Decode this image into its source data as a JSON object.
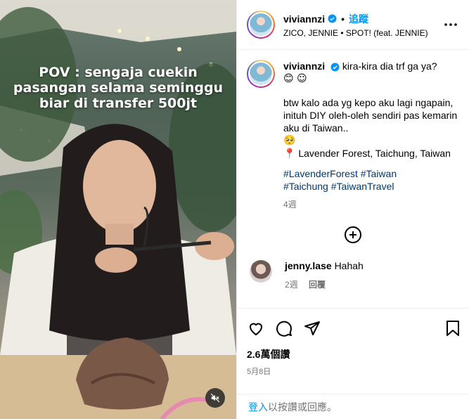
{
  "media": {
    "caption_lines": [
      "POV : sengaja cuekin",
      "pasangan selama seminggu",
      "biar di transfer 500jt"
    ],
    "mute_icon": "muted-speaker-icon"
  },
  "header": {
    "username": "viviannzi",
    "follow_label": "追蹤",
    "dot": "•",
    "music": "ZICO, JENNIE • SPOT! (feat. JENNIE)"
  },
  "post": {
    "username": "viviannzi",
    "text_line1": "kira-kira dia trf ga ya?",
    "emoji1": "😊 ☺",
    "para2": "btw kalo ada yg kepo aku lagi ngapain, inituh DIY oleh-oleh sendiri pas kemarin aku di Taiwan..",
    "emoji2": "🥺",
    "pin": "📍",
    "location": "Lavender Forest, Taichung, Taiwan",
    "tags": [
      "#LavenderForest",
      "#Taiwan",
      "#Taichung",
      "#TaiwanTravel"
    ],
    "age": "4週"
  },
  "comment": {
    "username": "jenny.lase",
    "text": "Hahah",
    "age": "2週",
    "reply_label": "回覆"
  },
  "stats": {
    "views": "2.6萬個讚",
    "date": "5月8日"
  },
  "login": {
    "link": "登入",
    "rest": "以按讚或回應。"
  },
  "colors": {
    "accent": "#0095f6",
    "hashtag": "#00376b",
    "muted": "#737373",
    "verified": "#0095f6"
  }
}
